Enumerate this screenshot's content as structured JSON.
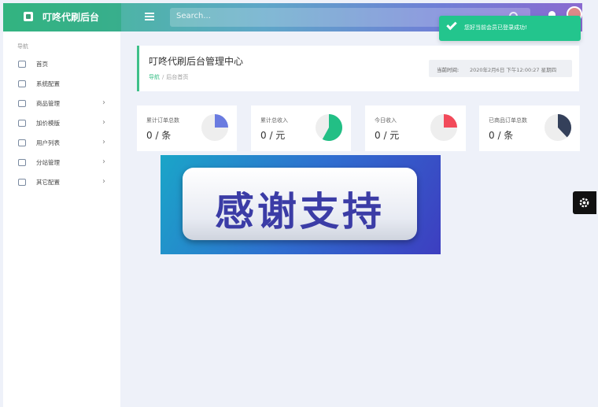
{
  "app": {
    "brand_name": "叮咚代刷后台",
    "search_placeholder": "Search..."
  },
  "toast": {
    "message": "您好当前会员已登录成功!"
  },
  "sidebar": {
    "heading": "导航",
    "items": [
      {
        "label": "首页",
        "icon": "home-icon",
        "has_arrow": false
      },
      {
        "label": "系统配置",
        "icon": "settings-icon",
        "has_arrow": false
      },
      {
        "label": "商品管理",
        "icon": "list-icon",
        "has_arrow": true
      },
      {
        "label": "加价模版",
        "icon": "template-icon",
        "has_arrow": true
      },
      {
        "label": "用户列表",
        "icon": "user-icon",
        "has_arrow": true
      },
      {
        "label": "分站管理",
        "icon": "monitor-icon",
        "has_arrow": true
      },
      {
        "label": "其它配置",
        "icon": "gear-icon",
        "has_arrow": true
      }
    ],
    "arrow_glyph": "›"
  },
  "header": {
    "title": "叮咚代刷后台管理中心",
    "breadcrumb": [
      "导航",
      "后台首页"
    ],
    "breadcrumb_sep": "/",
    "time_label": "当前时间:",
    "time_value": "2020年2月6日 下午12:00:27 星期四"
  },
  "stats": [
    {
      "label": "累计订单总数",
      "value": "0 / 条",
      "pie_color": "#6a7be0",
      "fraction": 0.25
    },
    {
      "label": "累计总收入",
      "value": "0 / 元",
      "pie_color": "#22bf85",
      "fraction": 0.58
    },
    {
      "label": "今日收入",
      "value": "0 / 元",
      "pie_color": "#f24a5a",
      "fraction": 0.25
    },
    {
      "label": "已商品订单总数",
      "value": "0 / 条",
      "pie_color": "#34405a",
      "fraction": 0.38
    }
  ],
  "banner": {
    "text": "感谢支持"
  },
  "colors": {
    "accent": "#3fc08a",
    "page_bg": "#eef1f9",
    "pie_track": "#eeeeee"
  }
}
